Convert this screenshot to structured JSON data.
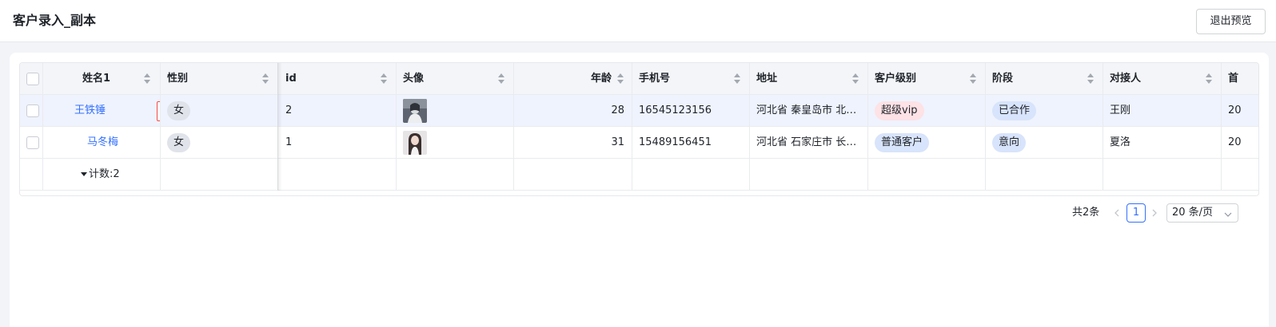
{
  "header": {
    "title": "客户录入_副本",
    "exit_preview_label": "退出预览"
  },
  "table": {
    "columns": [
      {
        "label": "姓名1",
        "sortable": true
      },
      {
        "label": "性别",
        "sortable": true
      },
      {
        "label": "id",
        "sortable": true
      },
      {
        "label": "头像",
        "sortable": true
      },
      {
        "label": "年龄",
        "sortable": true
      },
      {
        "label": "手机号",
        "sortable": true
      },
      {
        "label": "地址",
        "sortable": true
      },
      {
        "label": "客户级别",
        "sortable": true
      },
      {
        "label": "阶段",
        "sortable": true
      },
      {
        "label": "对接人",
        "sortable": true
      },
      {
        "label": "首",
        "sortable": false
      }
    ],
    "rows": [
      {
        "name": "王铁锤",
        "gender": "女",
        "id": "2",
        "avatar": "avatar-image",
        "age": "28",
        "phone": "16545123156",
        "address": "河北省 秦皇岛市 北…",
        "level": "超级vip",
        "stage": "已合作",
        "contact": "王刚",
        "first": "20"
      },
      {
        "name": "马冬梅",
        "gender": "女",
        "id": "1",
        "avatar": "avatar-image",
        "age": "31",
        "phone": "15489156451",
        "address": "河北省 石家庄市 长…",
        "level": "普通客户",
        "stage": "意向",
        "contact": "夏洛",
        "first": "20"
      }
    ],
    "summary": "计数:2"
  },
  "pagination": {
    "total": "共2条",
    "current_page": "1",
    "page_size": "20 条/页"
  },
  "colors": {
    "accent": "#3370ff",
    "header_bg": "#f3f5f9",
    "selected_row_bg": "#eff3fd",
    "edit_border": "#f54a45"
  }
}
